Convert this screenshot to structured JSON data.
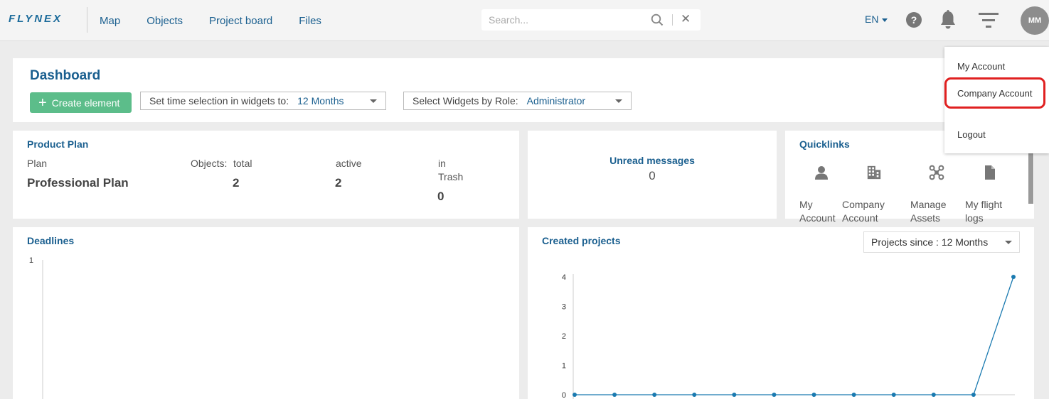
{
  "brand": {
    "logo_text": "FLYNEX"
  },
  "nav": {
    "items": [
      "Map",
      "Objects",
      "Project board",
      "Files"
    ]
  },
  "search": {
    "placeholder": "Search..."
  },
  "header": {
    "language": "EN",
    "avatar_initials": "MM"
  },
  "dashboard": {
    "title": "Dashboard",
    "create_label": "Create element",
    "time_select": {
      "label": "Set time selection in widgets to:",
      "value": "12 Months"
    },
    "role_select": {
      "label": "Select Widgets by Role:",
      "value": "Administrator"
    }
  },
  "product_plan": {
    "title": "Product Plan",
    "plan_label": "Plan",
    "plan_value": "Professional Plan",
    "objects_label": "Objects:",
    "total_label": "total",
    "total_value": "2",
    "active_label": "active",
    "active_value": "2",
    "trash_label_line1": "in",
    "trash_label_line2": "Trash",
    "trash_value": "0"
  },
  "unread": {
    "title": "Unread messages",
    "value": "0"
  },
  "quicklinks": {
    "title": "Quicklinks",
    "items": [
      {
        "line1": "My",
        "line2": "Account",
        "icon": "person-icon"
      },
      {
        "line1": "Company",
        "line2": "Account",
        "icon": "building-icon"
      },
      {
        "line1": "Manage",
        "line2": "Assets",
        "icon": "drone-icon"
      },
      {
        "line1": "My flight",
        "line2": "logs",
        "icon": "document-icon"
      }
    ]
  },
  "user_menu": {
    "items": [
      "My Account",
      "Company Account",
      "Logout"
    ],
    "highlighted": "Company Account",
    "highlight_color": "#e02020"
  },
  "deadlines": {
    "title": "Deadlines"
  },
  "created_projects": {
    "title": "Created projects",
    "since_label": "Projects since :",
    "since_value": "12 Months"
  },
  "chart_data": [
    {
      "type": "line",
      "title": "Deadlines",
      "y_ticks": [
        "1"
      ],
      "ylim": [
        0,
        1
      ],
      "series": []
    },
    {
      "type": "line",
      "title": "Created projects",
      "y_ticks": [
        "0",
        "1",
        "2",
        "3",
        "4"
      ],
      "ylim": [
        0,
        4
      ],
      "x": [
        1,
        2,
        3,
        4,
        5,
        6,
        7,
        8,
        9,
        10,
        11,
        12
      ],
      "series": [
        {
          "values": [
            0,
            0,
            0,
            0,
            0,
            0,
            0,
            0,
            0,
            0,
            0,
            4
          ]
        }
      ],
      "color": "#1a7ab0"
    }
  ]
}
